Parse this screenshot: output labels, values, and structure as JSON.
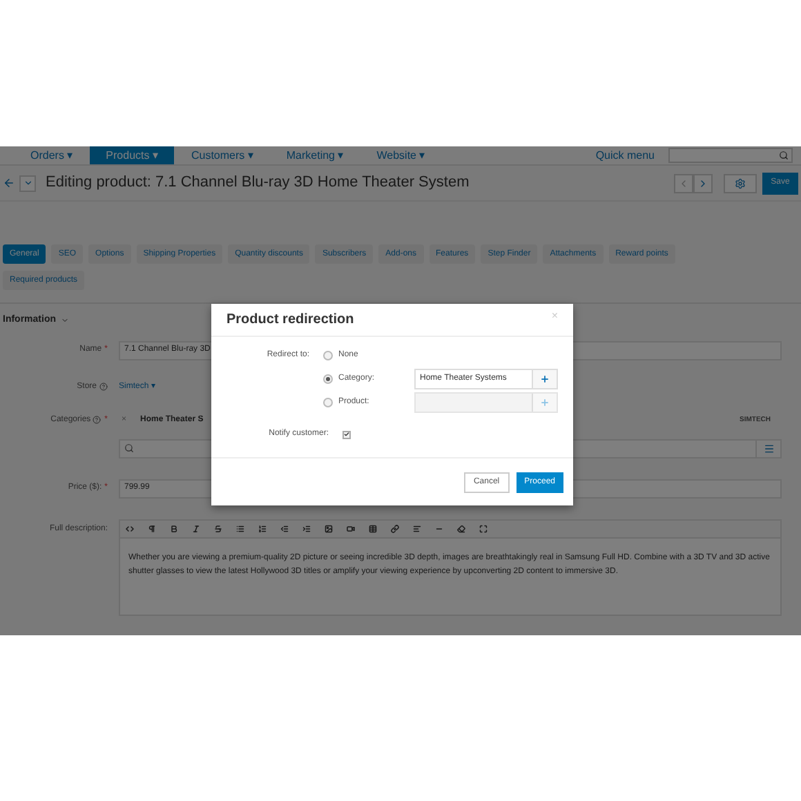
{
  "nav": {
    "items": [
      {
        "label": "Orders ▾",
        "selected": false
      },
      {
        "label": "Products ▾",
        "selected": true
      },
      {
        "label": "Customers ▾",
        "selected": false
      },
      {
        "label": "Marketing ▾",
        "selected": false
      },
      {
        "label": "Website ▾",
        "selected": false
      }
    ],
    "quick_menu": "Quick menu"
  },
  "header": {
    "title": "Editing product: 7.1 Channel Blu-ray 3D Home Theater System",
    "save": "Save"
  },
  "tabs": [
    {
      "label": "General",
      "selected": true
    },
    {
      "label": "SEO",
      "selected": false
    },
    {
      "label": "Options",
      "selected": false
    },
    {
      "label": "Shipping Properties",
      "selected": false
    },
    {
      "label": "Quantity discounts",
      "selected": false
    },
    {
      "label": "Subscribers",
      "selected": false
    },
    {
      "label": "Add-ons",
      "selected": false
    },
    {
      "label": "Features",
      "selected": false
    },
    {
      "label": "Step Finder",
      "selected": false
    },
    {
      "label": "Attachments",
      "selected": false
    },
    {
      "label": "Reward points",
      "selected": false
    },
    {
      "label": "Required products",
      "selected": false
    }
  ],
  "section": {
    "title": "Information"
  },
  "form": {
    "required_marks": [
      "*",
      "*",
      "*"
    ],
    "store_caret": "▾",
    "name_label": "Name",
    "name_value": "7.1 Channel Blu-ray 3D",
    "store_label": "Store",
    "store_value": "Simtech",
    "categories_label": "Categories",
    "category_tag": "Home Theater S",
    "category_remove": "×",
    "vendor": "SIMTECH",
    "price_label": "Price ($):",
    "price_value": "799.99",
    "description_label": "Full description:",
    "description": "Whether you are viewing a premium-quality 2D picture or seeing incredible 3D depth, images are breathtakingly real in Samsung Full HD. Combine with a 3D TV and 3D active shutter glasses to view the latest Hollywood 3D titles or amplify your viewing experience by upconverting 2D content to immersive 3D."
  },
  "modal": {
    "title": "Product redirection",
    "close": "×",
    "redirect_label": "Redirect to:",
    "options": [
      {
        "label": "None",
        "selected": false,
        "kind": "plain"
      },
      {
        "label": "Category:",
        "selected": true,
        "kind": "picker",
        "value": "Home Theater Systems"
      },
      {
        "label": "Product:",
        "selected": false,
        "kind": "picker"
      }
    ],
    "notify_label": "Notify customer:",
    "notify_checked": true,
    "cancel": "Cancel",
    "proceed": "Proceed"
  }
}
